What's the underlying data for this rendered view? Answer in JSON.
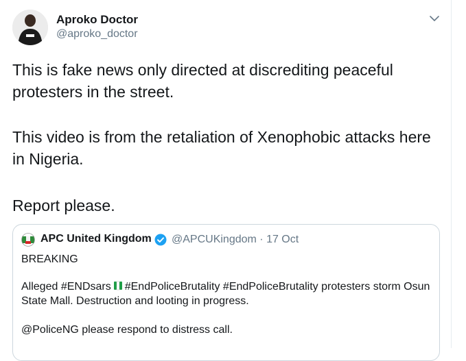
{
  "author": {
    "display_name": "Aproko Doctor",
    "handle": "@aproko_doctor"
  },
  "tweet": {
    "paragraph_1": "This is fake news only directed at discrediting peaceful protesters in the street.",
    "paragraph_2": "This video is from the retaliation of Xenophobic attacks here in Nigeria.",
    "paragraph_3": "Report please."
  },
  "quoted_tweet": {
    "display_name": "APC United Kingdom",
    "handle_and_date": "@APCUKingdom · 17 Oct",
    "line_1": "BREAKING",
    "line_2_before_icon": "Alleged #ENDsars",
    "line_2_after_icon": "#EndPoliceBrutality #EndPoliceBrutality protesters storm Osun State Mall. Destruction and looting in progress.",
    "line_3": "@PoliceNG please respond to distress call."
  },
  "colors": {
    "text_primary": "#14171a",
    "text_secondary": "#657786",
    "verified_blue": "#1da1f2",
    "border": "#ccd6dd"
  }
}
